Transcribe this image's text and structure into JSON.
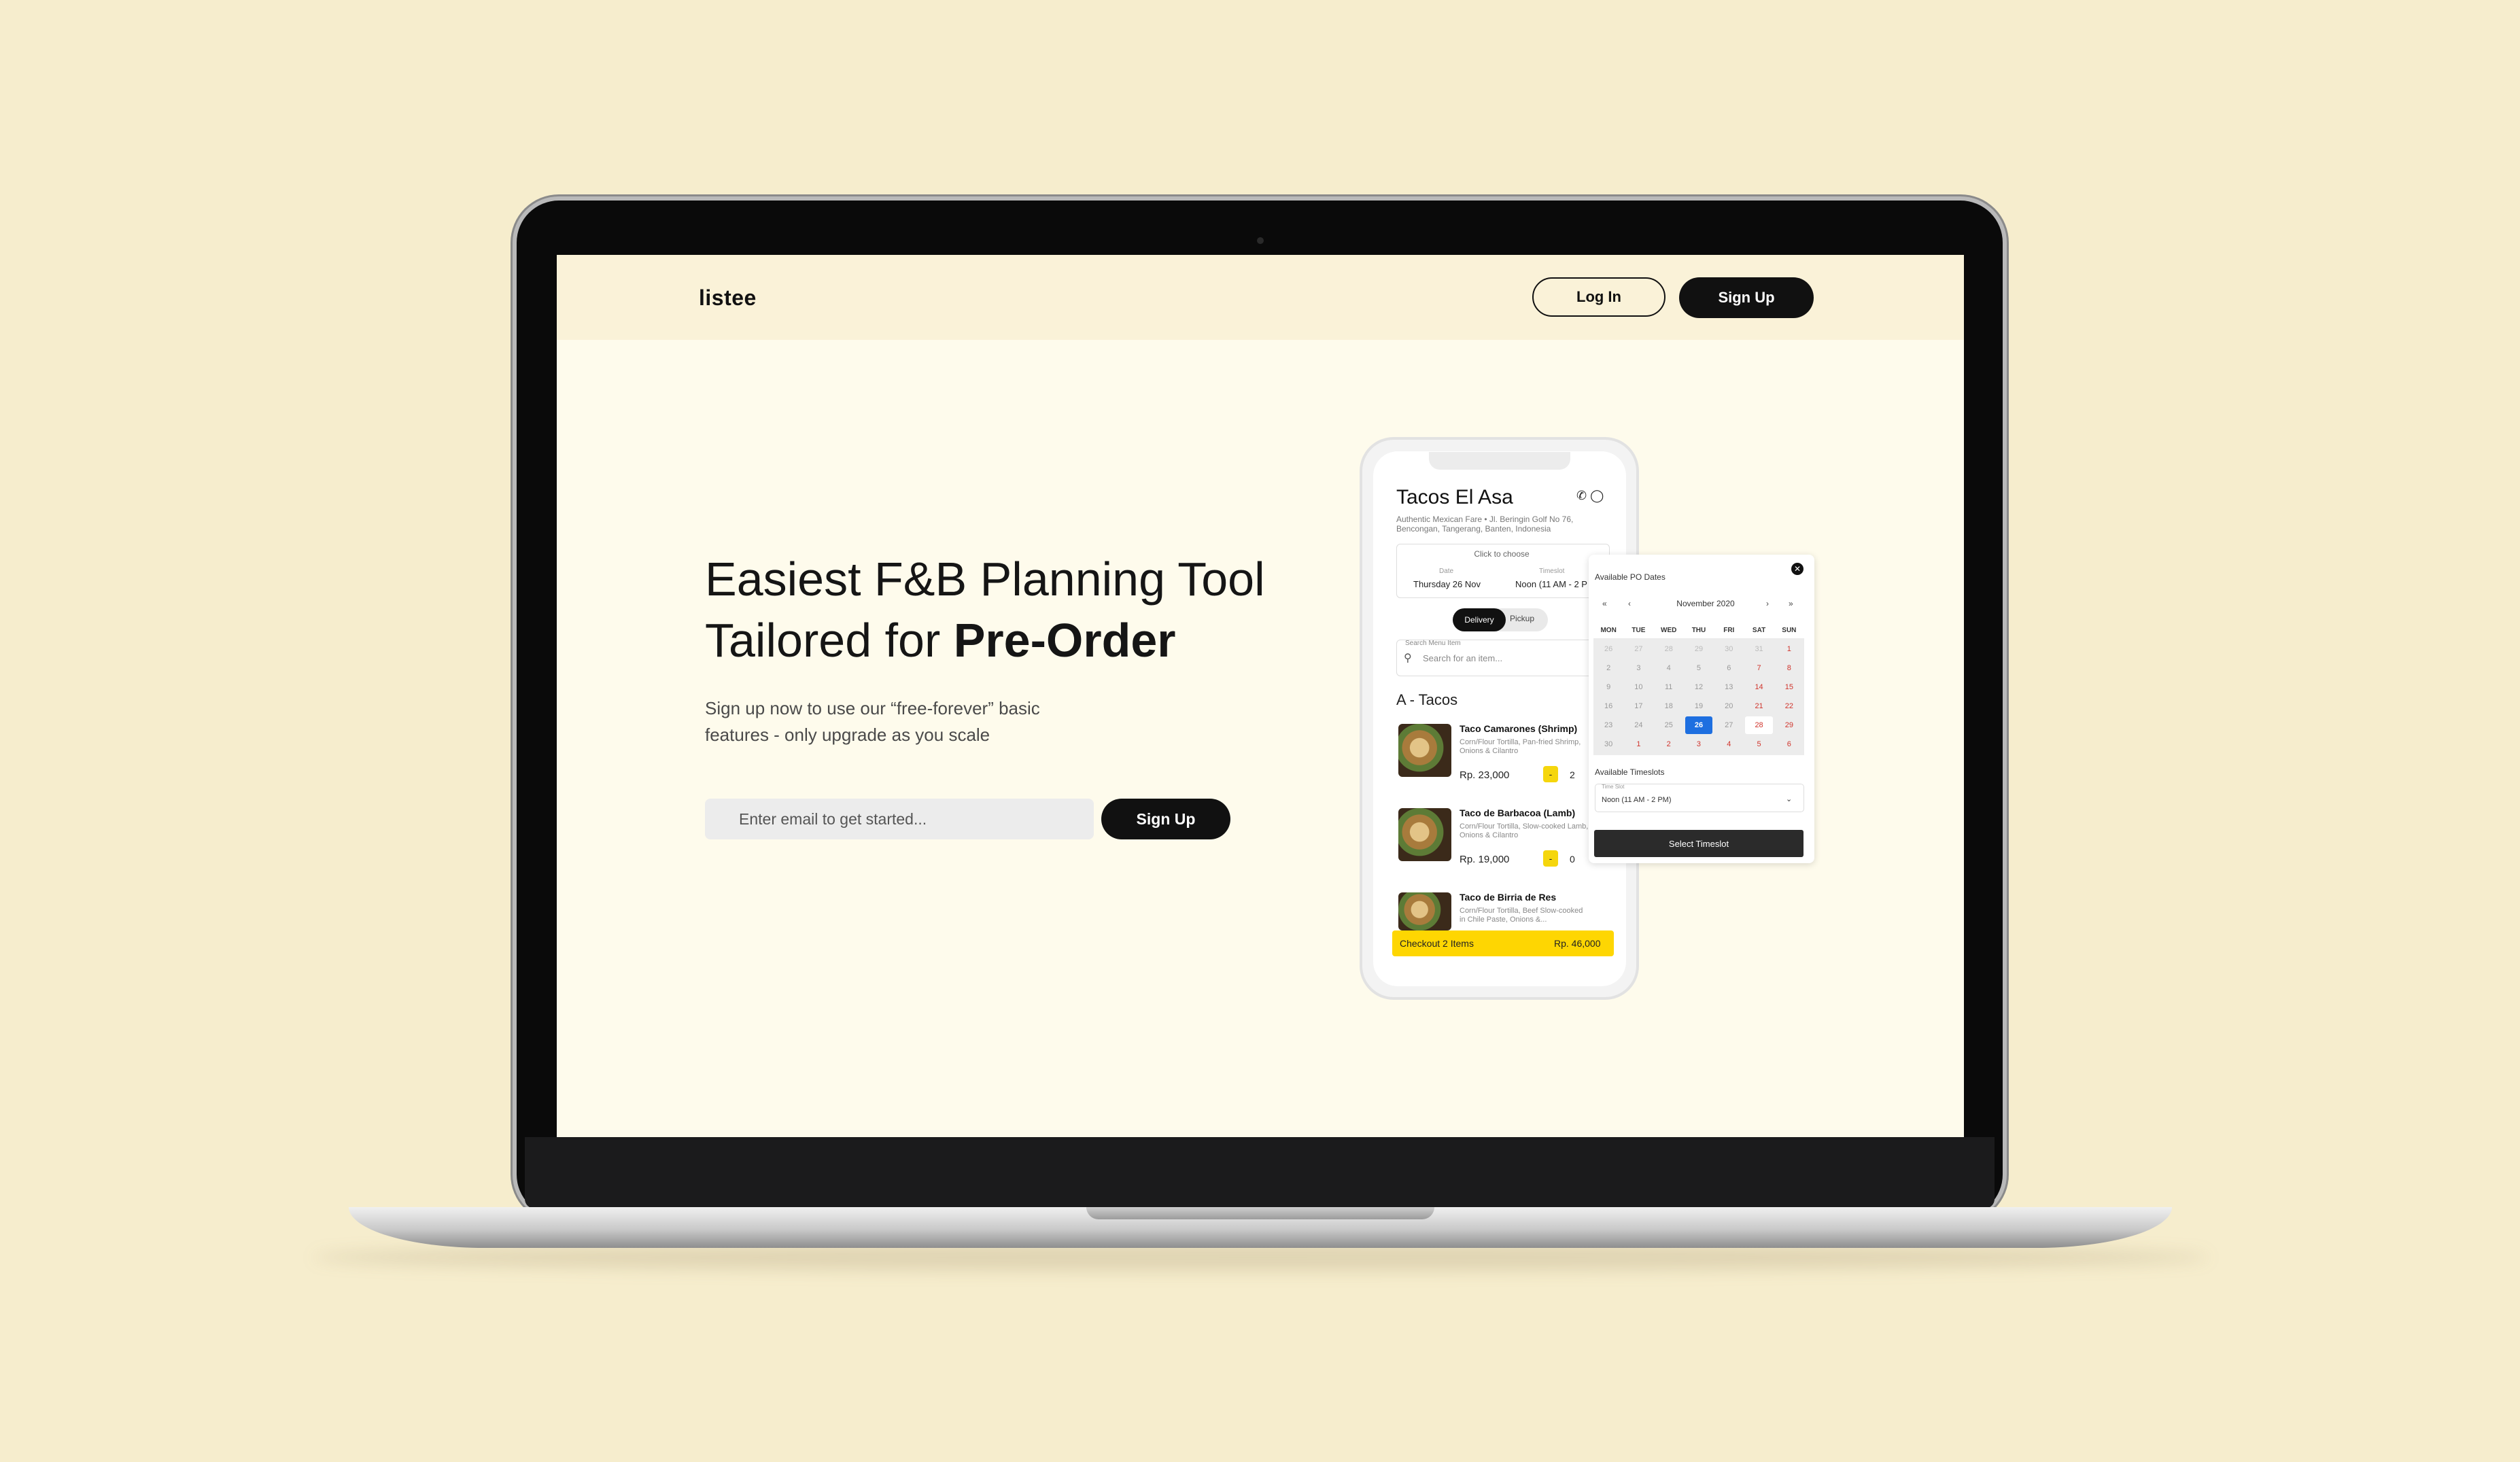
{
  "app": {
    "logo": "listee"
  },
  "nav": {
    "login_label": "Log In",
    "signup_label": "Sign Up"
  },
  "hero": {
    "headline_line1": "Easiest F&B Planning Tool",
    "headline_line2_prefix": "Tailored for ",
    "headline_line2_bold": "Pre-Order",
    "subtext": "Sign up now to use our “free-forever” basic features - only upgrade as you scale",
    "email_placeholder": "Enter email to get started...",
    "signup_label": "Sign Up"
  },
  "phone": {
    "title": "Tacos El Asa",
    "subtitle": "Authentic Mexican Fare • Jl. Beringin Golf No 76, Bencongan, Tangerang, Banten, Indonesia",
    "icons": [
      "whatsapp-icon",
      "instagram-icon"
    ],
    "date_box": {
      "hint": "Click to choose",
      "date_label": "Date",
      "date_value": "Thursday 26 Nov",
      "timeslot_label": "Timeslot",
      "timeslot_value": "Noon (11 AM - 2 P"
    },
    "toggle": {
      "delivery": "Delivery",
      "pickup": "Pickup",
      "active": "Delivery"
    },
    "search": {
      "label": "Search Menu Item",
      "placeholder": "Search for an item..."
    },
    "section_title": "A - Tacos",
    "items": [
      {
        "name": "Taco Camarones (Shrimp)",
        "desc": "Corn/Flour Tortilla, Pan-fried Shrimp, Onions & Cilantro",
        "price": "Rp. 23,000",
        "minus": "-",
        "qty": "2"
      },
      {
        "name": "Taco de Barbacoa (Lamb)",
        "desc": "Corn/Flour Tortilla, Slow-cooked Lamb, Onions & Cilantro",
        "price": "Rp. 19,000",
        "minus": "-",
        "qty": "0"
      },
      {
        "name": "Taco de Birria de Res",
        "desc": "Corn/Flour Tortilla, Beef Slow-cooked in Chile Paste, Onions &...",
        "price": "",
        "minus": "",
        "qty": ""
      }
    ],
    "checkout": {
      "label": "Checkout 2 Items",
      "total": "Rp. 46,000"
    }
  },
  "calendar": {
    "title": "Available PO Dates",
    "close_icon": "close-icon",
    "nav": {
      "prev_year": "«",
      "prev_month": "‹",
      "next_month": "›",
      "next_year": "»"
    },
    "month": "November 2020",
    "weekdays": [
      "MON",
      "TUE",
      "WED",
      "THU",
      "FRI",
      "SAT",
      "SUN"
    ],
    "weeks": [
      [
        "26",
        "27",
        "28",
        "29",
        "30",
        "31",
        "1"
      ],
      [
        "2",
        "3",
        "4",
        "5",
        "6",
        "7",
        "8"
      ],
      [
        "9",
        "10",
        "11",
        "12",
        "13",
        "14",
        "15"
      ],
      [
        "16",
        "17",
        "18",
        "19",
        "20",
        "21",
        "22"
      ],
      [
        "23",
        "24",
        "25",
        "26",
        "27",
        "28",
        "29"
      ],
      [
        "30",
        "1",
        "2",
        "3",
        "4",
        "5",
        "6"
      ]
    ],
    "selected_date": "26",
    "timeslot_title": "Available Timeslots",
    "timeslot_label": "Time Slot",
    "timeslot_value": "Noon (11 AM - 2 PM)",
    "select_button": "Select Timeslot",
    "colors": {
      "selected": "#1e6fe0",
      "available": "#d0342c"
    }
  },
  "colors": {
    "background": "#f6edcd",
    "accent_yellow": "#fed602",
    "dark": "#111111"
  }
}
